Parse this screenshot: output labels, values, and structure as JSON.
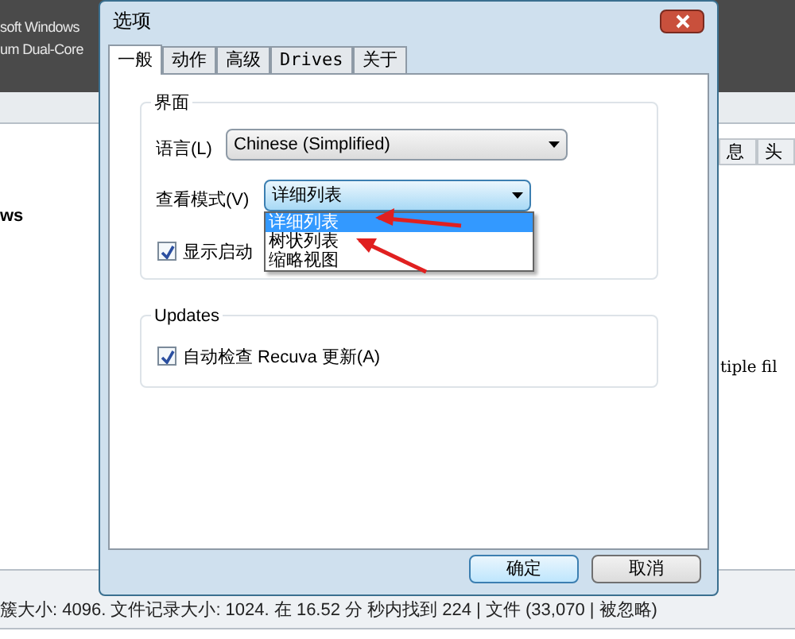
{
  "background_app": {
    "header_lines": [
      "soft Windows",
      "um Dual-Core"
    ],
    "left_label": "ws",
    "column_headers": [
      "息",
      "头"
    ],
    "right_text": "tiple fil",
    "status_bar": "簇大小: 4096. 文件记录大小: 1024. 在 16.52 分 秒内找到 224 | 文件 (33,070 | 被忽略)"
  },
  "dialog": {
    "title": "选项",
    "tabs": [
      {
        "label": "一般",
        "selected": true
      },
      {
        "label": "动作",
        "selected": false
      },
      {
        "label": "高级",
        "selected": false
      },
      {
        "label": "Drives",
        "selected": false
      },
      {
        "label": "关于",
        "selected": false
      }
    ],
    "interface_group": {
      "title": "界面",
      "language_label": "语言(L)",
      "language_value": "Chinese (Simplified)",
      "view_mode_label": "查看模式(V)",
      "view_mode_value": "详细列表",
      "view_mode_options": [
        {
          "label": "详细列表",
          "selected": true
        },
        {
          "label": "树状列表",
          "selected": false
        },
        {
          "label": "缩略视图",
          "selected": false
        }
      ],
      "startup_checkbox": {
        "label": "显示启动",
        "checked": true
      }
    },
    "updates_group": {
      "title": "Updates",
      "auto_check": {
        "label": "自动检查 Recuva 更新(A)",
        "checked": true
      }
    },
    "buttons": [
      "确定",
      "取消"
    ]
  }
}
